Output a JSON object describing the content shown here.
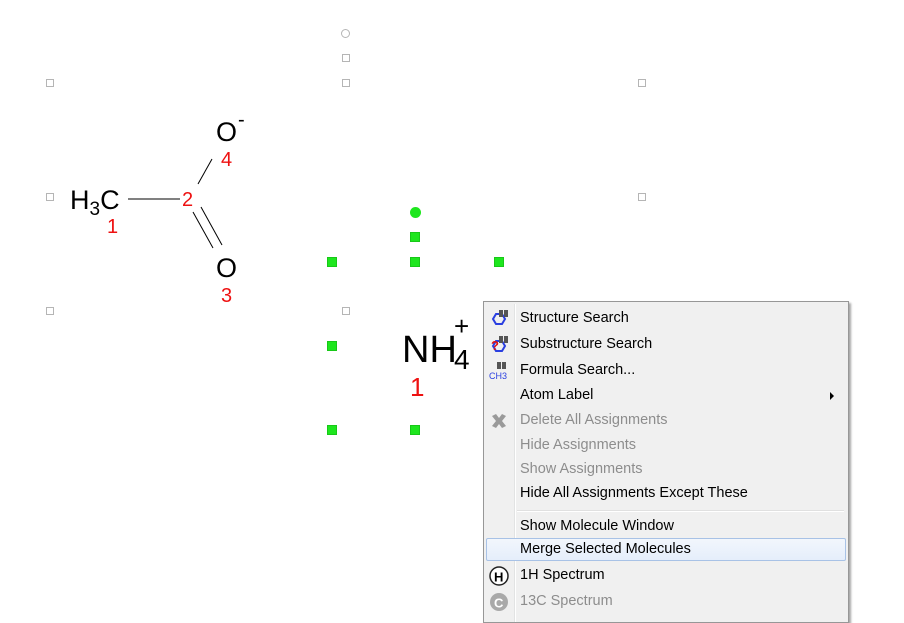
{
  "molecules": {
    "acetate": {
      "atoms": [
        {
          "label": "H",
          "sub": "3",
          "tail": "C",
          "number": "1"
        },
        {
          "label": "",
          "number": "2"
        },
        {
          "label": "O",
          "number": "3"
        },
        {
          "label": "O",
          "number": "4",
          "charge": "-"
        }
      ]
    },
    "ammonium": {
      "label": "NH",
      "sub": "4",
      "charge": "+",
      "number": "1"
    }
  },
  "colors": {
    "atom_number": "#ee1111",
    "selection_handle": "#1ee61e",
    "menu_background": "#f0f0f0",
    "menu_hover_border": "#a8c2e6",
    "disabled_text": "#8d8d8d"
  },
  "context_menu": {
    "items": [
      {
        "label": "Structure Search",
        "icon": "structure-search-icon",
        "enabled": true
      },
      {
        "label": "Substructure Search",
        "icon": "substructure-search-icon",
        "enabled": true
      },
      {
        "label": "Formula Search...",
        "icon": "formula-search-icon",
        "enabled": true
      },
      {
        "label": "Atom Label",
        "submenu": true,
        "enabled": true
      },
      {
        "label": "Delete All Assignments",
        "icon": "delete-assignments-icon",
        "enabled": false
      },
      {
        "label": "Hide Assignments",
        "enabled": false
      },
      {
        "label": "Show Assignments",
        "enabled": false
      },
      {
        "label": "Hide All Assignments Except These",
        "enabled": true
      },
      {
        "label": "Show Molecule Window",
        "enabled": true
      },
      {
        "label": "Merge Selected Molecules",
        "enabled": true,
        "highlighted": true
      },
      {
        "label": "1H Spectrum",
        "icon": "1h-spectrum-icon",
        "enabled": true
      },
      {
        "label": "13C Spectrum",
        "icon": "13c-spectrum-icon",
        "enabled": false
      }
    ]
  },
  "icon_glyphs": {
    "formula_search": "CH3",
    "h_spectrum": "H",
    "c_spectrum": "C"
  }
}
